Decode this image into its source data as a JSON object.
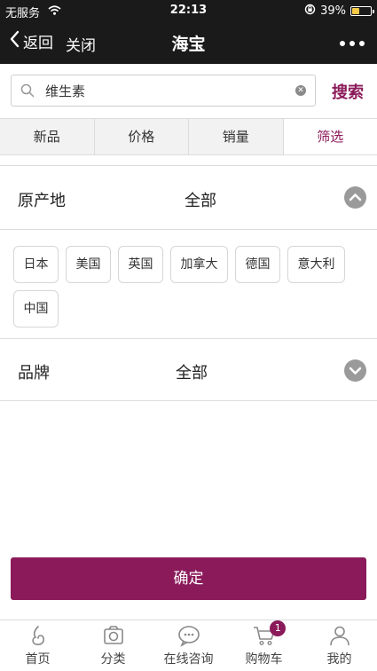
{
  "status_bar": {
    "carrier": "无服务",
    "time": "22:13",
    "battery_pct": "39%",
    "battery_level": 0.39
  },
  "nav": {
    "back_label": "返回",
    "close_label": "关闭",
    "title": "海宝"
  },
  "search": {
    "value": "维生素",
    "placeholder": "",
    "button_label": "搜索"
  },
  "tabs": [
    {
      "label": "新品"
    },
    {
      "label": "价格"
    },
    {
      "label": "销量"
    },
    {
      "label": "筛选",
      "active": true
    }
  ],
  "filters": {
    "origin": {
      "label": "原产地",
      "value": "全部",
      "expanded": true,
      "options": [
        "日本",
        "美国",
        "英国",
        "加拿大",
        "德国",
        "意大利",
        "中国"
      ]
    },
    "brand": {
      "label": "品牌",
      "value": "全部",
      "expanded": false
    }
  },
  "confirm_label": "确定",
  "tabbar": [
    {
      "label": "首页",
      "icon": "home-icon"
    },
    {
      "label": "分类",
      "icon": "category-icon"
    },
    {
      "label": "在线咨询",
      "icon": "chat-icon"
    },
    {
      "label": "购物车",
      "icon": "cart-icon",
      "badge": "1"
    },
    {
      "label": "我的",
      "icon": "profile-icon"
    }
  ],
  "colors": {
    "accent": "#8b1a5a",
    "bar_bg": "#1a1a1a",
    "icon_gray": "#9a9a9a"
  }
}
